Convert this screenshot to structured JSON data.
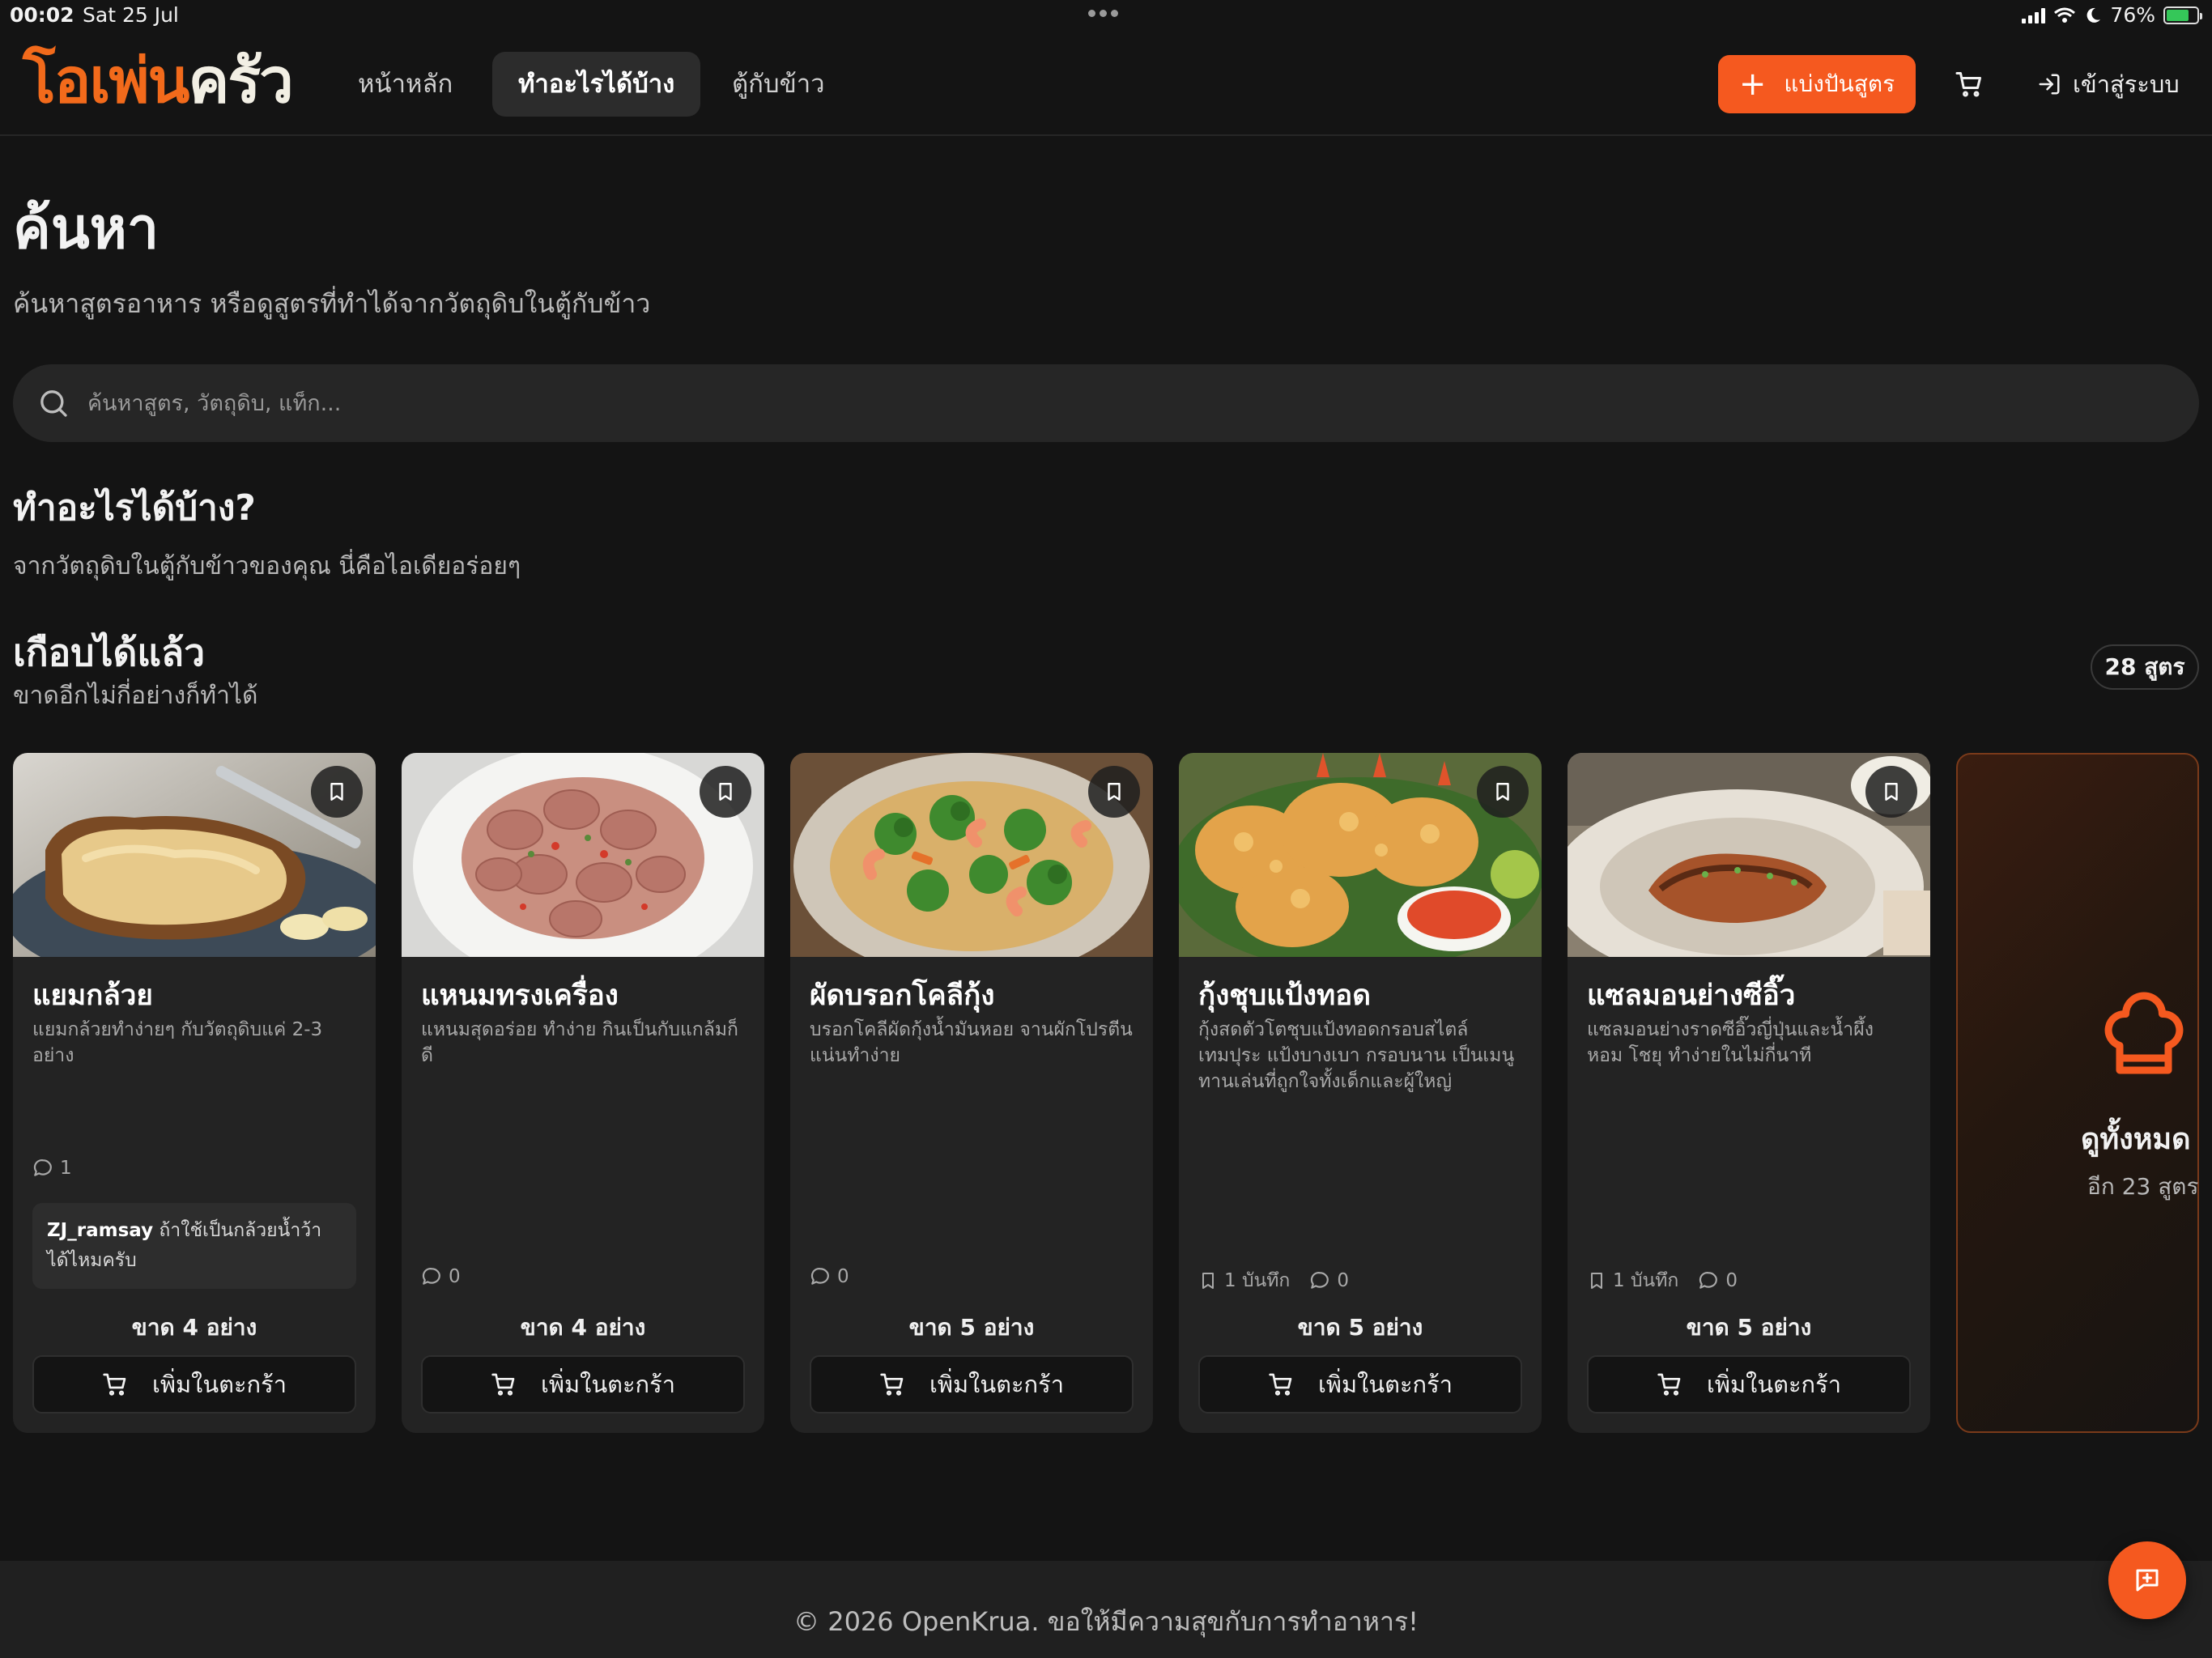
{
  "status_bar": {
    "time": "00:02",
    "date": "Sat 25 Jul",
    "battery": "76%"
  },
  "brand": {
    "logo_part1": "โอเพ่น",
    "logo_part2": "ครัว",
    "accent": "#f5591f"
  },
  "nav": {
    "items": [
      {
        "label": "หน้าหลัก",
        "active": false
      },
      {
        "label": "ทำอะไรได้บ้าง",
        "active": true
      },
      {
        "label": "ตู้กับข้าว",
        "active": false
      }
    ],
    "share_label": "แบ่งปันสูตร",
    "login_label": "เข้าสู่ระบบ"
  },
  "page": {
    "title": "ค้นหา",
    "subtitle": "ค้นหาสูตรอาหาร หรือดูสูตรที่ทำได้จากวัตถุดิบในตู้กับข้าว",
    "search_placeholder": "ค้นหาสูตร, วัตถุดิบ, แท็ก..."
  },
  "section": {
    "title": "ทำอะไรได้บ้าง?",
    "subtitle": "จากวัตถุดิบในตู้กับข้าวของคุณ นี่คือไอเดียอร่อยๆ"
  },
  "group": {
    "title": "เกือบได้แล้ว",
    "subtitle": "ขาดอีกไม่กี่อย่างก็ทำได้",
    "count": "28 สูตร"
  },
  "recipes": [
    {
      "title": "แยมกล้วย",
      "description": "แยมกล้วยทำง่ายๆ กับวัตถุดิบแค่ 2-3 อย่าง",
      "comments": "1",
      "saves": "",
      "comment_user": "ZJ_ramsay",
      "comment_text": "ถ้าใช้เป็นกล้วยน้ำว้าได้ไหมครับ",
      "missing": "ขาด 4 อย่าง",
      "add_label": "เพิ่มในตะกร้า",
      "image": "banana-jam-toast"
    },
    {
      "title": "แหนมทรงเครื่อง",
      "description": "แหนมสุดอร่อย ทำง่าย กินเป็นกับแกล้มก็ดี",
      "comments": "0",
      "saves": "",
      "missing": "ขาด 4 อย่าง",
      "add_label": "เพิ่มในตะกร้า",
      "image": "nham-salad"
    },
    {
      "title": "ผัดบรอกโคลีกุ้ง",
      "description": "บรอกโคลีผัดกุ้งน้ำมันหอย จานผักโปรตีนแน่นทำง่าย",
      "comments": "0",
      "saves": "",
      "missing": "ขาด 5 อย่าง",
      "add_label": "เพิ่มในตะกร้า",
      "image": "broccoli-shrimp"
    },
    {
      "title": "กุ้งชุบแป้งทอด",
      "description": "กุ้งสดตัวโตชุบแป้งทอดกรอบสไตล์เทมปุระ แป้งบางเบา กรอบนาน เป็นเมนูทานเล่นที่ถูกใจทั้งเด็กและผู้ใหญ่",
      "comments": "0",
      "saves": "1 บันทึก",
      "missing": "ขาด 5 อย่าง",
      "add_label": "เพิ่มในตะกร้า",
      "image": "fried-shrimp"
    },
    {
      "title": "แซลมอนย่างซีอิ๊ว",
      "description": "แซลมอนย่างราดซีอิ๊วญี่ปุ่นและน้ำผึ้ง หอม โชยุ ทำง่ายในไม่กี่นาที",
      "comments": "0",
      "saves": "1 บันทึก",
      "missing": "ขาด 5 อย่าง",
      "add_label": "เพิ่มในตะกร้า",
      "image": "grilled-salmon"
    }
  ],
  "view_all": {
    "title": "ดูทั้งหมด",
    "subtitle": "อีก 23 สูตร"
  },
  "footer": {
    "text": "© 2026 OpenKrua. ขอให้มีความสุขกับการทำอาหาร!"
  }
}
